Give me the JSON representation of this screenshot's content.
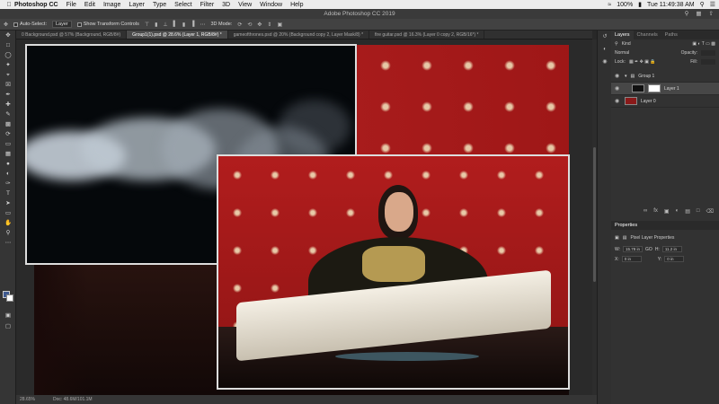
{
  "menubar": {
    "app_name": "Photoshop CC",
    "items": [
      "File",
      "Edit",
      "Image",
      "Layer",
      "Type",
      "Select",
      "Filter",
      "3D",
      "View",
      "Window",
      "Help"
    ],
    "battery": "100%",
    "clock": "Tue 11:49:38 AM"
  },
  "window": {
    "title": "Adobe Photoshop CC 2019"
  },
  "options": {
    "auto_select_label": "Auto-Select:",
    "auto_select_value": "Layer",
    "transform_label": "Show Transform Controls",
    "mode_label": "3D Mode:"
  },
  "tabs": [
    "0 Background.psd @ 57% (Background, RGB/8#)",
    "Group1(1).psd @ 28.6% (Layer 1, RGB/8#) *",
    "gameofthrones.psd @ 20% (Background copy 2, Layer Mask/8) *",
    "fire guitar.psd @ 16.3% (Layer 0 copy 2, RGB/16*) *"
  ],
  "active_tab": 1,
  "status": {
    "zoom": "28.65%",
    "doc": "Doc: 48.6M/101.1M"
  },
  "panels": {
    "layers_tabs": [
      "Layers",
      "Channels",
      "Paths"
    ],
    "kind_label": "Kind",
    "blend_mode": "Normal",
    "opacity_label": "Opacity:",
    "lock_label": "Lock:",
    "fill_label": "Fill:",
    "layers": [
      {
        "name": "Group 1",
        "type": "group"
      },
      {
        "name": "Layer 1",
        "type": "layer",
        "selected": true
      },
      {
        "name": "Layer 0",
        "type": "layer"
      }
    ],
    "properties_title": "Properties",
    "properties_sub": "Pixel Layer Properties",
    "w_label": "W:",
    "w_value": "15.78 in",
    "h_label": "H:",
    "h_value": "11.2 in",
    "x_label": "X:",
    "x_value": "0 in",
    "y_label": "Y:",
    "y_value": "0 in",
    "go_label": "GO"
  },
  "colors": {
    "foreground": "#3f5a8f",
    "background": "#ffffff"
  }
}
